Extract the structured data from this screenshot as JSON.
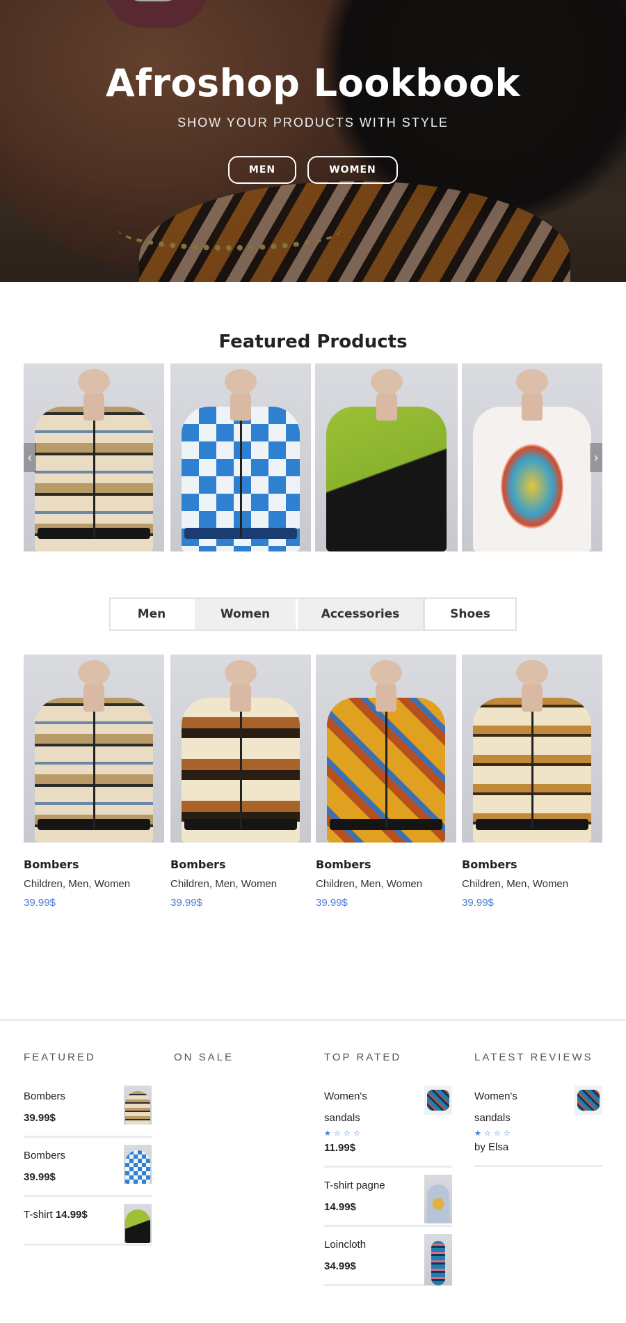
{
  "hero": {
    "title": "Afroshop Lookbook",
    "subtitle": "SHOW YOUR PRODUCTS WITH STYLE",
    "buttons": [
      "MEN",
      "WOMEN"
    ]
  },
  "featured": {
    "title": "Featured Products",
    "prev_icon": "chevron-left-icon",
    "next_icon": "chevron-right-icon",
    "prev_glyph": "‹",
    "next_glyph": "›"
  },
  "tabs": [
    "Men",
    "Women",
    "Accessories",
    "Shoes"
  ],
  "products": [
    {
      "name": "Bombers",
      "categories": "Children, Men, Women",
      "price": "39.99$"
    },
    {
      "name": "Bombers",
      "categories": "Children, Men, Women",
      "price": "39.99$"
    },
    {
      "name": "Bombers",
      "categories": "Children, Men, Women",
      "price": "39.99$"
    },
    {
      "name": "Bombers",
      "categories": "Children, Men, Women",
      "price": "39.99$"
    }
  ],
  "widgets": {
    "featured": {
      "title": "FEATURED",
      "items": [
        {
          "name": "Bombers",
          "price": "39.99$"
        },
        {
          "name": "Bombers",
          "price": "39.99$"
        },
        {
          "name": "T-shirt",
          "price": "14.99$"
        }
      ]
    },
    "on_sale": {
      "title": "ON SALE"
    },
    "top_rated": {
      "title": "TOP RATED",
      "items": [
        {
          "name": "Women's sandals",
          "price": "11.99$",
          "rating": 1
        },
        {
          "name": "T-shirt pagne",
          "price": "14.99$"
        },
        {
          "name": "Loincloth",
          "price": "34.99$"
        }
      ]
    },
    "latest_reviews": {
      "title": "LATEST REVIEWS",
      "items": [
        {
          "name": "Women's sandals",
          "by": "by Elsa",
          "rating": 1
        }
      ]
    }
  },
  "colors": {
    "accent": "#4a7bd0",
    "divider": "#ececec"
  }
}
